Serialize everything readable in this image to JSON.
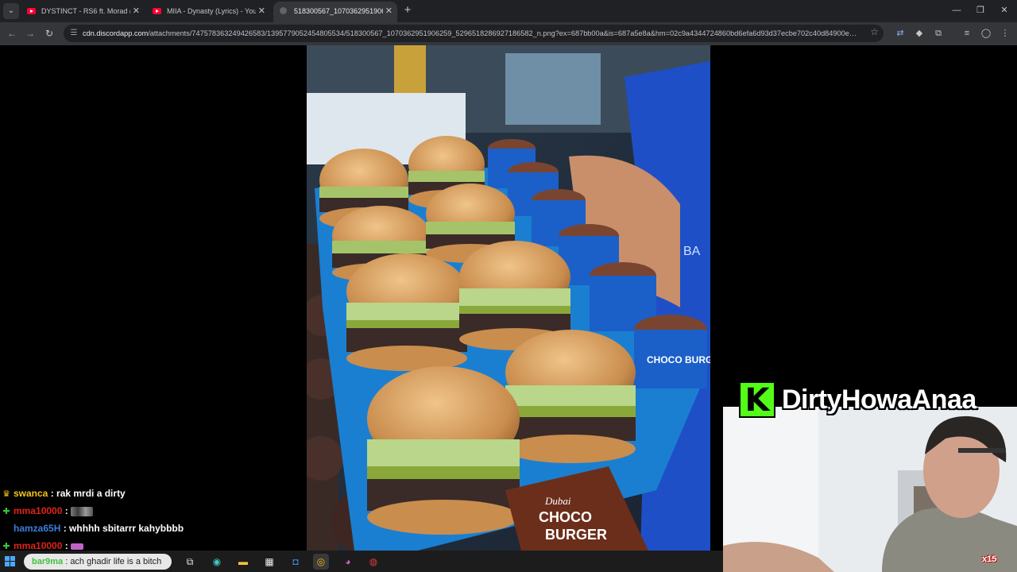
{
  "browser": {
    "tabs": [
      {
        "title": "DYSTINCT - RS6 ft. Morad (Official",
        "icon": "youtube-icon",
        "active": false
      },
      {
        "title": "MIIA - Dynasty (Lyrics) - YouTube",
        "icon": "youtube-icon",
        "active": false
      },
      {
        "title": "518300567_1070362951906259",
        "icon": "globe-icon",
        "active": true
      }
    ],
    "url_host": "cdn.discordapp.com",
    "url_path": "/attachments/747578363249426583/1395779052454805534/518300567_1070362951906259_5296518286927186582_n.png?ex=687bb00a&is=687a5e8a&hm=02c9a4344724860bd6efa6d93d37ecbe702c40d84900e64..."
  },
  "chat": [
    {
      "badge": "crown",
      "user": "swanca",
      "text": "rak mrdi a dirty",
      "color": "u1",
      "emote": false
    },
    {
      "badge": "diamond",
      "user": "mma10000",
      "text": "",
      "color": "u2",
      "emote": true
    },
    {
      "badge": "",
      "user": "hamza65H",
      "text": "whhhh sbitarrr kahybbbb",
      "color": "u3",
      "emote": false
    },
    {
      "badge": "diamond",
      "user": "mma10000",
      "text": "",
      "color": "u2",
      "emote": true,
      "emote_small": true
    },
    {
      "badge": "diamond",
      "user": "bar9ma",
      "text": "ach ghadir  life is a bitch",
      "color": "u4",
      "emote": false
    }
  ],
  "overlay": {
    "brand_letter": "K",
    "streamer_name": "DirtyHowaAnaa",
    "watermark": "x15"
  },
  "photo": {
    "cup_label": "CHOCO BURGER",
    "box_text_1": "Dubai",
    "box_text_2": "CHOCO",
    "box_text_3": "BURGER",
    "apron_text": "BA"
  },
  "colors": {
    "kick_green": "#53fc18",
    "tab_bg": "#202124",
    "toolbar_bg": "#35363a"
  }
}
